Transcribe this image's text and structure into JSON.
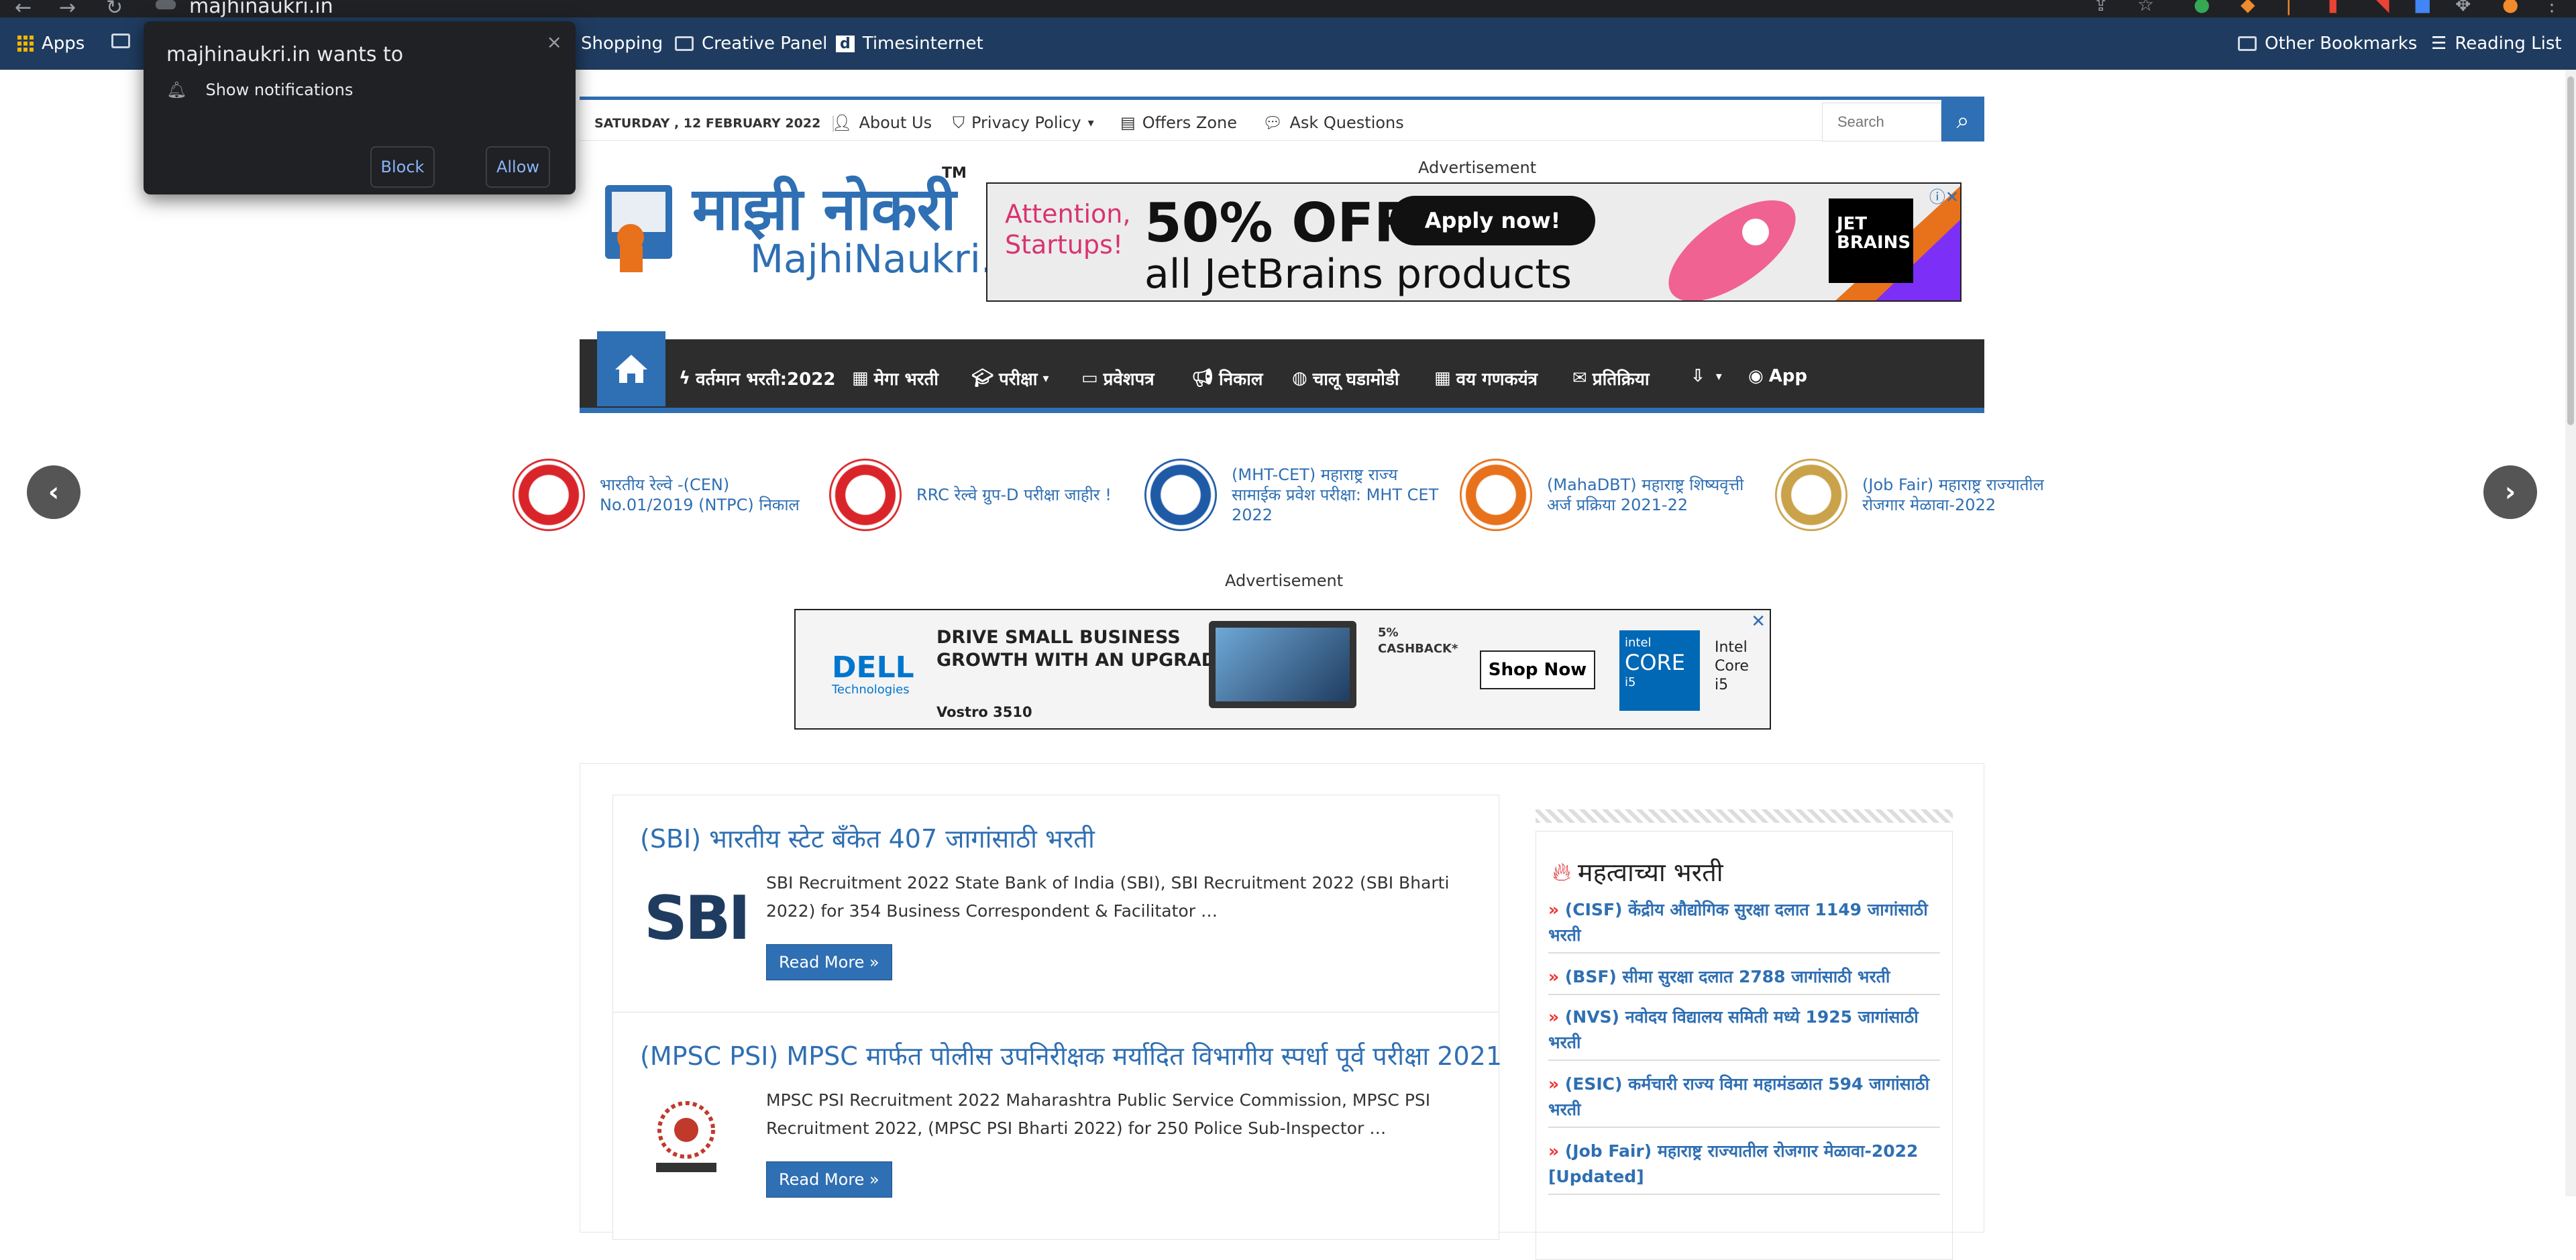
{
  "browser": {
    "url": "majhinaukri.in"
  },
  "bookmarks": {
    "apps": "Apps",
    "shopping": "Shopping",
    "creative": "Creative Panel",
    "times": "Timesinternet",
    "other": "Other Bookmarks",
    "reading": "Reading List"
  },
  "popup": {
    "title": "majhinaukri.in wants to",
    "item": "Show notifications",
    "block": "Block",
    "allow": "Allow",
    "close": "×"
  },
  "topbar": {
    "date": "SATURDAY , 12 FEBRUARY 2022",
    "about": "About Us",
    "privacy": "Privacy Policy",
    "offers": "Offers Zone",
    "ask": "Ask Questions",
    "search_placeholder": "Search"
  },
  "logo": {
    "marathi": "माझी नोकरी",
    "english": "MajhiNaukri.in",
    "tm": "TM"
  },
  "ad1": {
    "label": "Advertisement",
    "line1": "Attention,",
    "line2": "Startups!",
    "headline": "50% OFF",
    "sub": "all JetBrains products",
    "cta": "Apply now!",
    "brand1": "JET",
    "brand2": "BRAINS"
  },
  "nav": {
    "items": [
      "वर्तमान भरती:2022",
      "मेगा भरती",
      "परीक्षा",
      "प्रवेशपत्र",
      "निकाल",
      "चालू घडामोडी",
      "वय गणकयंत्र",
      "प्रतिक्रिया",
      "",
      "App"
    ]
  },
  "slider": [
    {
      "text": "भारतीय रेल्वे -(CEN) No.01/2019 (NTPC) निकाल",
      "color": "#d9252a"
    },
    {
      "text": "RRC रेल्वे ग्रुप-D परीक्षा जाहीर !",
      "color": "#d9252a"
    },
    {
      "text": "(MHT-CET) महाराष्ट्र राज्य सामाईक प्रवेश परीक्षा: MHT CET 2022",
      "color": "#1f5aa6"
    },
    {
      "text": "(MahaDBT) महाराष्ट्र शिष्यवृत्ती अर्ज प्रक्रिया 2021-22",
      "color": "#e8711c"
    },
    {
      "text": "(Job Fair) महाराष्ट्र राज्यातील रोजगार मेळावा-2022",
      "color": "#c9a24a"
    }
  ],
  "ad2": {
    "label": "Advertisement",
    "brand": "DELL",
    "brand_sub": "Technologies",
    "model": "Vostro 3510",
    "head1": "DRIVE SMALL BUSINESS",
    "head2": "GROWTH WITH AN UPGRADE",
    "cashback1": "5%",
    "cashback2": "CASHBACK*",
    "cta": "Shop Now",
    "chip1": "intel",
    "chip2": "CORE",
    "chip3": "i5",
    "intel": "Intel Core i5"
  },
  "posts": [
    {
      "title": "(SBI) भारतीय स्टेट बँकेत 407 जागांसाठी भरती",
      "excerpt": "SBI Recruitment 2022 State Bank of India (SBI),  SBI Recruitment 2022 (SBI Bharti 2022) for 354 Business Correspondent & Facilitator …",
      "more": "Read More »",
      "logo": "SBI"
    },
    {
      "title": "(MPSC PSI) MPSC मार्फत पोलीस उपनिरीक्षक मर्यादित विभागीय स्पर्धा पूर्व परीक्षा 2021",
      "excerpt": "MPSC PSI Recruitment 2022 Maharashtra Public Service Commission, MPSC PSI Recruitment 2022, (MPSC PSI Bharti 2022) for 250 Police Sub-Inspector …",
      "more": "Read More »"
    }
  ],
  "sidebar": {
    "heading": "महत्वाच्या भरती",
    "links": [
      "(CISF) केंद्रीय औद्योगिक सुरक्षा दलात 1149 जागांसाठी भरती",
      "(BSF) सीमा सुरक्षा दलात 2788 जागांसाठी भरती",
      "(NVS) नवोदय विद्यालय समिती मध्ये 1925 जागांसाठी भरती",
      "(ESIC) कर्मचारी राज्य विमा महामंडळात 594 जागांसाठी भरती",
      "(Job Fair) महाराष्ट्र राज्यातील रोजगार मेळावा-2022 [Updated]"
    ]
  }
}
